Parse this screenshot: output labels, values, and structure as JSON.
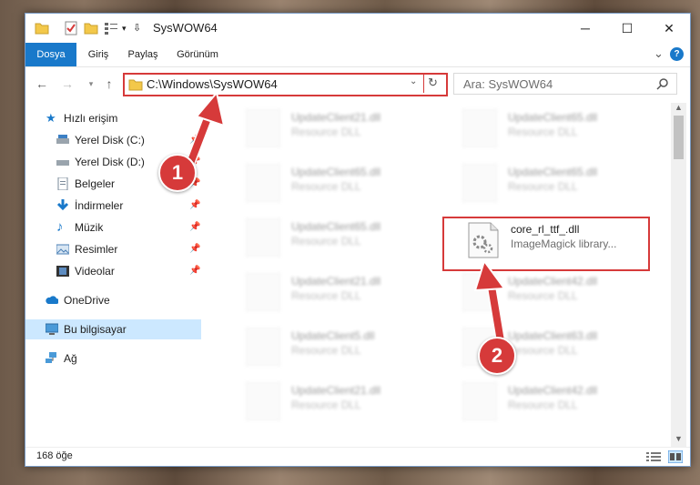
{
  "window": {
    "title": "SysWOW64",
    "minimize_glyph": "─",
    "maximize_glyph": "☐",
    "close_glyph": "✕"
  },
  "ribbon": {
    "tabs": [
      {
        "label": "Dosya"
      },
      {
        "label": "Giriş"
      },
      {
        "label": "Paylaş"
      },
      {
        "label": "Görünüm"
      }
    ],
    "expand_glyph": "⌄",
    "help_glyph": "?"
  },
  "nav": {
    "address": "C:\\Windows\\SysWOW64",
    "search_placeholder": "Ara: SysWOW64"
  },
  "sidebar": {
    "items": [
      {
        "label": "Hızlı erişim",
        "icon": "star-icon",
        "indent": false,
        "pinned": false
      },
      {
        "label": "Yerel Disk (C:)",
        "icon": "drive-icon",
        "indent": true,
        "pinned": true
      },
      {
        "label": "Yerel Disk (D:)",
        "icon": "drive-icon",
        "indent": true,
        "pinned": true
      },
      {
        "label": "Belgeler",
        "icon": "documents-icon",
        "indent": true,
        "pinned": true
      },
      {
        "label": "İndirmeler",
        "icon": "download-icon",
        "indent": true,
        "pinned": true
      },
      {
        "label": "Müzik",
        "icon": "music-icon",
        "indent": true,
        "pinned": true
      },
      {
        "label": "Resimler",
        "icon": "pictures-icon",
        "indent": true,
        "pinned": true
      },
      {
        "label": "Videolar",
        "icon": "videos-icon",
        "indent": true,
        "pinned": true
      },
      {
        "label": "OneDrive",
        "icon": "cloud-icon",
        "indent": false,
        "pinned": false
      },
      {
        "label": "Bu bilgisayar",
        "icon": "computer-icon",
        "indent": false,
        "pinned": false,
        "selected": true
      },
      {
        "label": "Ağ",
        "icon": "network-icon",
        "indent": false,
        "pinned": false
      }
    ]
  },
  "files": [
    {
      "name": "UpdateClient21.dll",
      "desc": "Resource DLL",
      "blurred": true
    },
    {
      "name": "UpdateClient65.dll",
      "desc": "Resource DLL",
      "blurred": true
    },
    {
      "name": "UpdateClient65.dll",
      "desc": "Resource DLL",
      "blurred": true
    },
    {
      "name": "UpdateClient65.dll",
      "desc": "Resource DLL",
      "blurred": true
    },
    {
      "name": "UpdateClient65.dll",
      "desc": "Resource DLL",
      "blurred": true
    },
    {
      "name": "core_rl_ttf_.dll",
      "desc": "ImageMagick library...",
      "blurred": false
    },
    {
      "name": "UpdateClient21.dll",
      "desc": "Resource DLL",
      "blurred": true
    },
    {
      "name": "UpdateClient42.dll",
      "desc": "Resource DLL",
      "blurred": true
    },
    {
      "name": "UpdateClient5.dll",
      "desc": "Resource DLL",
      "blurred": true
    },
    {
      "name": "UpdateClient63.dll",
      "desc": "Resource DLL",
      "blurred": true
    },
    {
      "name": "UpdateClient21.dll",
      "desc": "Resource DLL",
      "blurred": true
    },
    {
      "name": "UpdateClient42.dll",
      "desc": "Resource DLL",
      "blurred": true
    }
  ],
  "annotations": {
    "step1": "1",
    "step2": "2",
    "color": "#d63a3a"
  },
  "status": {
    "count": "168 öğe"
  }
}
